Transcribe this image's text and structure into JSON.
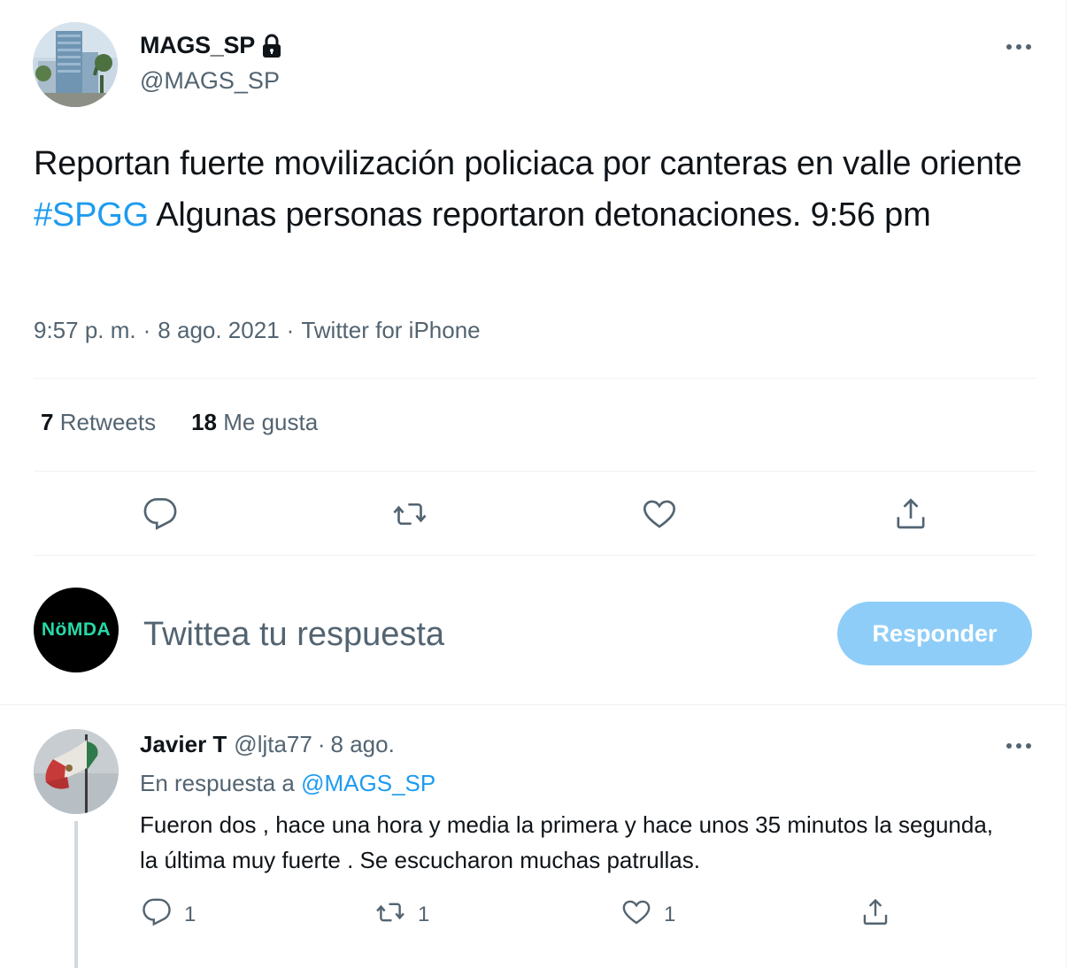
{
  "tweet": {
    "display_name": "MAGS_SP",
    "handle": "@MAGS_SP",
    "text_before": "Reportan fuerte movilización policiaca por canteras en valle oriente ",
    "hashtag": "#SPGG",
    "text_after": " Algunas personas reportaron detonaciones. 9:56 pm",
    "time": "9:57 p. m.",
    "date": "8 ago. 2021",
    "source": "Twitter for iPhone",
    "separator": "·",
    "retweets_count": "7",
    "retweets_label": "Retweets",
    "likes_count": "18",
    "likes_label": "Me gusta"
  },
  "compose": {
    "avatar_text": "NöMDA",
    "placeholder": "Twittea tu respuesta",
    "button_label": "Responder"
  },
  "reply": {
    "display_name": "Javier T",
    "handle": "@ljta77",
    "date": "8 ago.",
    "separator": "·",
    "in_reply_prefix": "En respuesta a ",
    "mention": "@MAGS_SP",
    "text": "Fueron dos , hace una hora y media la primera y hace unos 35 minutos la segunda, la última muy fuerte . Se escucharon muchas patrullas.",
    "reply_count": "1",
    "retweet_count": "1",
    "like_count": "1"
  },
  "colors": {
    "accent": "#1d9bf0",
    "secondary_text": "#536471",
    "button_disabled": "#8ecdf8",
    "divider": "#eff3f4"
  }
}
